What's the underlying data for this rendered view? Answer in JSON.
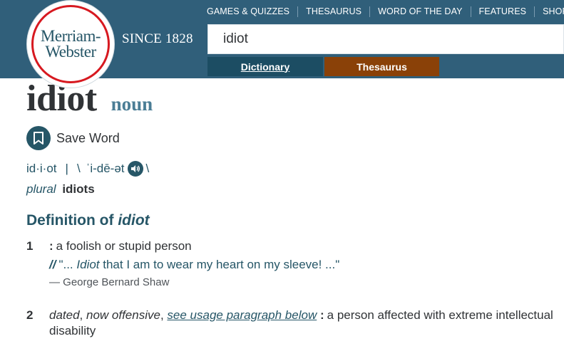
{
  "logo": {
    "line1": "Merriam-",
    "line2": "Webster"
  },
  "since": "SINCE 1828",
  "topnav": [
    "GAMES & QUIZZES",
    "THESAURUS",
    "WORD OF THE DAY",
    "FEATURES",
    "SHOP"
  ],
  "search": {
    "value": "idiot"
  },
  "tabs": {
    "dictionary": "Dictionary",
    "thesaurus": "Thesaurus"
  },
  "entry": {
    "headword": "idiot",
    "pos": "noun",
    "save_label": "Save Word",
    "syllables": "id·i·ot",
    "separator": "|",
    "slash_open": "\\",
    "pronunciation": "ˈi-dē-ət",
    "slash_close": "\\",
    "plural_label": "plural",
    "plural_word": "idiots"
  },
  "definition": {
    "heading_prefix": "Definition of",
    "heading_word": "idiot",
    "senses": [
      {
        "num": "1",
        "colon": ":",
        "text": "a foolish or stupid person",
        "quote_slashes": "//",
        "quote_open": "\"... ",
        "quote_em": "Idiot",
        "quote_rest": " that I am to wear my heart on my sleeve! ...\"",
        "attribution": "— George Bernard Shaw"
      },
      {
        "num": "2",
        "label1": "dated",
        "comma1": ", ",
        "label2": "now offensive",
        "comma2": ", ",
        "link": "see usage paragraph below",
        "colon": ":",
        "text": "a person affected with extreme intellectual disability"
      }
    ]
  },
  "colors": {
    "header_bg": "#305f7a",
    "brand_dark": "#265667",
    "tab_dictionary": "#1c4d63",
    "tab_thesaurus": "#8a4108",
    "logo_ring": "#d71920"
  }
}
